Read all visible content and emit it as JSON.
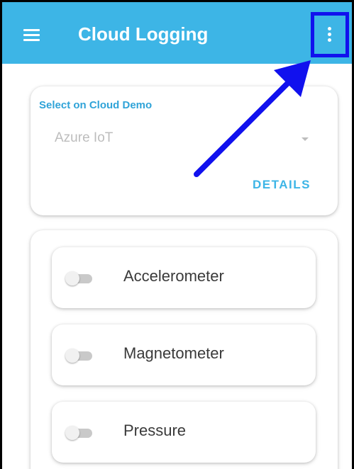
{
  "app_bar": {
    "title": "Cloud Logging",
    "menu_icon": "hamburger-menu-icon",
    "overflow_icon": "more-vert-icon",
    "background": "#3db5e6"
  },
  "cloud_select": {
    "label": "Select on Cloud Demo",
    "value": "Azure IoT",
    "details_label": "DETAILS",
    "accent": "#2fa3d8"
  },
  "sensors": [
    {
      "label": "Accelerometer",
      "enabled": false
    },
    {
      "label": "Magnetometer",
      "enabled": false
    },
    {
      "label": "Pressure",
      "enabled": false
    }
  ],
  "annotation": {
    "highlight_color": "#1111ee",
    "arrow_icon": "pointer-arrow-icon"
  }
}
